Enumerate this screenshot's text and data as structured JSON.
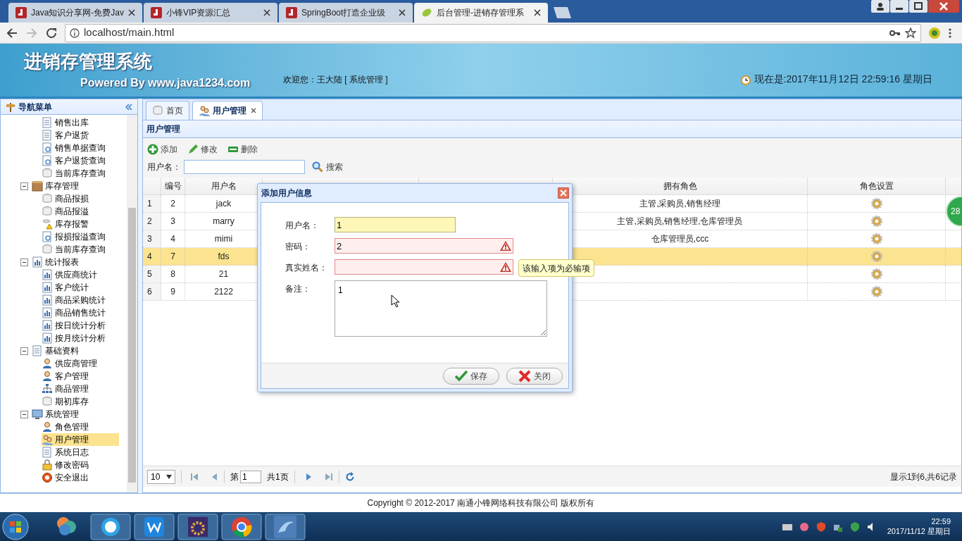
{
  "browser": {
    "tabs": [
      {
        "label": "Java知识分享网-免费Jav",
        "selected": false,
        "kind": "java"
      },
      {
        "label": "小锋VIP资源汇总",
        "selected": false,
        "kind": "java"
      },
      {
        "label": "SpringBoot打造企业级",
        "selected": false,
        "kind": "java"
      },
      {
        "label": "后台管理-进销存管理系",
        "selected": true,
        "kind": "leaf"
      }
    ],
    "address": "localhost/main.html"
  },
  "header": {
    "title": "进销存管理系统",
    "subtitle": "Powered By www.java1234.com",
    "welcome": "欢迎您：王大陆 [ 系统管理 ]",
    "clock": "现在是:2017年11月12日 22:59:16 星期日"
  },
  "sidebar": {
    "title": "导航菜单",
    "tree": [
      {
        "label": "销售出库",
        "kind": "doc",
        "selected": false
      },
      {
        "label": "客户退货",
        "kind": "doc",
        "selected": false
      },
      {
        "label": "销售单据查询",
        "kind": "search",
        "selected": false
      },
      {
        "label": "客户退货查询",
        "kind": "search",
        "selected": false
      },
      {
        "label": "当前库存查询",
        "kind": "db",
        "selected": false
      },
      {
        "label": "库存管理",
        "kind": "box",
        "expanded": true,
        "selected": false,
        "children": [
          {
            "label": "商品报损",
            "kind": "db",
            "selected": false
          },
          {
            "label": "商品报溢",
            "kind": "db",
            "selected": false
          },
          {
            "label": "库存报警",
            "kind": "warn",
            "selected": false
          },
          {
            "label": "报损报溢查询",
            "kind": "search",
            "selected": false
          },
          {
            "label": "当前库存查询",
            "kind": "db",
            "selected": false
          }
        ]
      },
      {
        "label": "统计报表",
        "kind": "chart",
        "expanded": true,
        "selected": false,
        "children": [
          {
            "label": "供应商统计",
            "kind": "chart",
            "selected": false
          },
          {
            "label": "客户统计",
            "kind": "chart",
            "selected": false
          },
          {
            "label": "商品采购统计",
            "kind": "chart",
            "selected": false
          },
          {
            "label": "商品销售统计",
            "kind": "chart",
            "selected": false
          },
          {
            "label": "按日统计分析",
            "kind": "chart",
            "selected": false
          },
          {
            "label": "按月统计分析",
            "kind": "chart",
            "selected": false
          }
        ]
      },
      {
        "label": "基础资料",
        "kind": "doc",
        "expanded": true,
        "selected": false,
        "children": [
          {
            "label": "供应商管理",
            "kind": "user",
            "selected": false
          },
          {
            "label": "客户管理",
            "kind": "user",
            "selected": false
          },
          {
            "label": "商品管理",
            "kind": "tree",
            "selected": false
          },
          {
            "label": "期初库存",
            "kind": "db",
            "selected": false
          }
        ]
      },
      {
        "label": "系统管理",
        "kind": "monitor",
        "expanded": true,
        "selected": false,
        "children": [
          {
            "label": "角色管理",
            "kind": "user",
            "selected": false
          },
          {
            "label": "用户管理",
            "kind": "users",
            "selected": true
          },
          {
            "label": "系统日志",
            "kind": "doc",
            "selected": false
          },
          {
            "label": "修改密码",
            "kind": "lock",
            "selected": false
          },
          {
            "label": "安全退出",
            "kind": "exit",
            "selected": false
          }
        ]
      }
    ]
  },
  "tabs": [
    {
      "label": "首页",
      "selected": false,
      "closable": false
    },
    {
      "label": "用户管理",
      "selected": true,
      "closable": true
    }
  ],
  "panel": {
    "title": "用户管理",
    "toolbar": [
      {
        "label": "添加",
        "kind": "add"
      },
      {
        "label": "修改",
        "kind": "edit"
      },
      {
        "label": "删除",
        "kind": "delete"
      }
    ],
    "search": {
      "label": "用户名：",
      "button": "搜索"
    }
  },
  "table": {
    "columns": [
      "编号",
      "用户名",
      "拥有角色",
      "角色设置"
    ],
    "rows": [
      {
        "row_number": "1",
        "id": "2",
        "username": "jack",
        "roles": "主管,采购员,销售经理",
        "selected": false
      },
      {
        "row_number": "2",
        "id": "3",
        "username": "marry",
        "roles": "主管,采购员,销售经理,仓库管理员",
        "selected": false
      },
      {
        "row_number": "3",
        "id": "4",
        "username": "mimi",
        "roles": "仓库管理员,ccc",
        "selected": false
      },
      {
        "row_number": "4",
        "id": "7",
        "username": "fds",
        "selected": true
      },
      {
        "row_number": "5",
        "id": "8",
        "username": "21",
        "selected": false
      },
      {
        "row_number": "6",
        "id": "9",
        "username": "2122",
        "selected": false
      }
    ]
  },
  "pagination": {
    "page_size": "10",
    "page_label": "第",
    "page": "1",
    "total_pages": "共1页",
    "summary": "显示1到6,共6记录"
  },
  "dialog": {
    "title": "添加用户信息",
    "fields": [
      {
        "label": "用户名：",
        "value": "1",
        "invalid": false,
        "kind": "input"
      },
      {
        "label": "密码：",
        "value": "2",
        "invalid": true,
        "kind": "input"
      },
      {
        "label": "真实姓名：",
        "invalid": true,
        "kind": "input"
      },
      {
        "label": "备注：",
        "value": "1",
        "kind": "textarea"
      }
    ],
    "tooltip": "该输入项为必输项",
    "buttons": [
      {
        "label": "保存",
        "kind": "save"
      },
      {
        "label": "关闭",
        "kind": "close"
      }
    ]
  },
  "side_badge": "28",
  "footer": "Copyright © 2012-2017 南通小锋网络科技有限公司 版权所有",
  "taskbar": {
    "time": "22:59",
    "date": "2017/11/12 星期日"
  }
}
